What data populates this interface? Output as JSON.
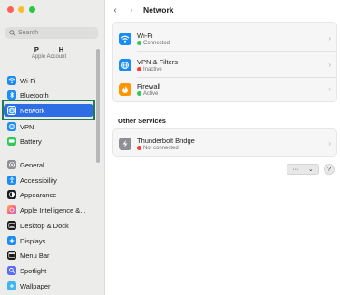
{
  "window": {
    "traffic_lights": {
      "close": "#ff5f57",
      "minimize": "#febc2e",
      "maximize": "#28c840"
    }
  },
  "sidebar": {
    "search_placeholder": "Search",
    "account": {
      "name": "P H",
      "subtitle": "Apple Account"
    },
    "items": [
      {
        "label": "Wi-Fi",
        "icon": "wifi-icon",
        "color": "#1a8cf4"
      },
      {
        "label": "Bluetooth",
        "icon": "bluetooth-icon",
        "color": "#1a8cf4"
      },
      {
        "label": "Network",
        "icon": "globe-icon",
        "color": "#1a8cf4",
        "selected": true
      },
      {
        "label": "VPN",
        "icon": "vpn-icon",
        "color": "#1a8cf4"
      },
      {
        "label": "Battery",
        "icon": "battery-icon",
        "color": "#34c759"
      },
      {
        "label": "General",
        "icon": "gear-icon",
        "color": "#8e8e93"
      },
      {
        "label": "Accessibility",
        "icon": "accessibility-icon",
        "color": "#1a8cf4"
      },
      {
        "label": "Appearance",
        "icon": "appearance-icon",
        "color": "#1c1c1e"
      },
      {
        "label": "Apple Intelligence &...",
        "icon": "apple-intelligence-icon",
        "color": "#ff7a59"
      },
      {
        "label": "Desktop & Dock",
        "icon": "dock-icon",
        "color": "#1c1c1e"
      },
      {
        "label": "Displays",
        "icon": "display-icon",
        "color": "#1a8cf4"
      },
      {
        "label": "Menu Bar",
        "icon": "menu-bar-icon",
        "color": "#1c1c1e"
      },
      {
        "label": "Spotlight",
        "icon": "spotlight-icon",
        "color": "#5c6bf0"
      },
      {
        "label": "Wallpaper",
        "icon": "wallpaper-icon",
        "color": "#3fb4f0"
      }
    ]
  },
  "toolbar": {
    "back": "‹",
    "forward": "›",
    "title": "Network"
  },
  "main": {
    "services": [
      {
        "title": "Wi-Fi",
        "status": "Connected",
        "status_color": "#34c759",
        "icon": "wifi-icon",
        "color": "#1a8cf4"
      },
      {
        "title": "VPN & Filters",
        "status": "Inactive",
        "status_color": "#ff3b30",
        "icon": "vpn-filters-icon",
        "color": "#1a8cf4"
      },
      {
        "title": "Firewall",
        "status": "Active",
        "status_color": "#34c759",
        "icon": "firewall-icon",
        "color": "#ff9500"
      }
    ],
    "other_heading": "Other Services",
    "other_services": [
      {
        "title": "Thunderbolt Bridge",
        "status": "Not connected",
        "status_color": "#ff3b30",
        "icon": "thunderbolt-icon",
        "color": "#8e8e93"
      }
    ],
    "more_label": "···",
    "more_chevron": "⌄",
    "help_label": "?"
  }
}
